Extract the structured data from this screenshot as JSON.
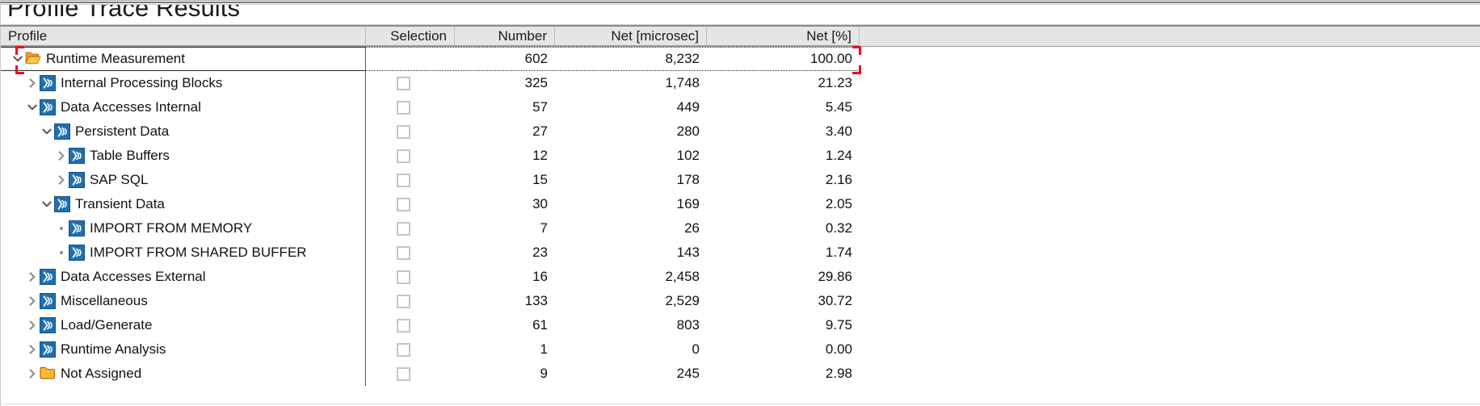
{
  "window": {
    "title": "Profile Trace Results"
  },
  "colors": {
    "header_bg": "#e6e6e6",
    "selection_marker": "#e81123",
    "folder_icon": "#f5b324",
    "node_icon": "#1e6eb4",
    "text": "#111111",
    "grid_line": "#bdbdbd"
  },
  "table": {
    "columns": [
      {
        "key": "profile",
        "label": "Profile",
        "align": "left"
      },
      {
        "key": "selection",
        "label": "Selection",
        "align": "right"
      },
      {
        "key": "number",
        "label": "Number",
        "align": "right"
      },
      {
        "key": "net_microsec",
        "label": "Net [microsec]",
        "align": "right"
      },
      {
        "key": "net_percent",
        "label": "Net [%]",
        "align": "right"
      }
    ],
    "rows": [
      {
        "label": "Runtime Measurement",
        "depth": 0,
        "twisty": "expanded",
        "icon": "folder-open-icon",
        "checkbox": false,
        "selected": true,
        "number": "602",
        "net_microsec": "8,232",
        "net_percent": "100.00"
      },
      {
        "label": "Internal Processing Blocks",
        "depth": 1,
        "twisty": "collapsed",
        "icon": "trace-node-icon",
        "checkbox": true,
        "checked": false,
        "selected": false,
        "number": "325",
        "net_microsec": "1,748",
        "net_percent": "21.23"
      },
      {
        "label": "Data Accesses Internal",
        "depth": 1,
        "twisty": "expanded",
        "icon": "trace-node-icon",
        "checkbox": true,
        "checked": false,
        "selected": false,
        "number": "57",
        "net_microsec": "449",
        "net_percent": "5.45"
      },
      {
        "label": "Persistent Data",
        "depth": 2,
        "twisty": "expanded",
        "icon": "trace-node-icon",
        "checkbox": true,
        "checked": false,
        "selected": false,
        "number": "27",
        "net_microsec": "280",
        "net_percent": "3.40"
      },
      {
        "label": "Table Buffers",
        "depth": 3,
        "twisty": "collapsed",
        "icon": "trace-node-icon",
        "checkbox": true,
        "checked": false,
        "selected": false,
        "number": "12",
        "net_microsec": "102",
        "net_percent": "1.24"
      },
      {
        "label": "SAP SQL",
        "depth": 3,
        "twisty": "collapsed",
        "icon": "trace-node-icon",
        "checkbox": true,
        "checked": false,
        "selected": false,
        "number": "15",
        "net_microsec": "178",
        "net_percent": "2.16"
      },
      {
        "label": "Transient Data",
        "depth": 2,
        "twisty": "expanded",
        "icon": "trace-node-icon",
        "checkbox": true,
        "checked": false,
        "selected": false,
        "number": "30",
        "net_microsec": "169",
        "net_percent": "2.05"
      },
      {
        "label": "IMPORT FROM MEMORY",
        "depth": 3,
        "twisty": "leaf",
        "icon": "trace-node-icon",
        "checkbox": true,
        "checked": false,
        "selected": false,
        "number": "7",
        "net_microsec": "26",
        "net_percent": "0.32"
      },
      {
        "label": "IMPORT FROM SHARED BUFFER",
        "depth": 3,
        "twisty": "leaf",
        "icon": "trace-node-icon",
        "checkbox": true,
        "checked": false,
        "selected": false,
        "number": "23",
        "net_microsec": "143",
        "net_percent": "1.74"
      },
      {
        "label": "Data Accesses External",
        "depth": 1,
        "twisty": "collapsed",
        "icon": "trace-node-icon",
        "checkbox": true,
        "checked": false,
        "selected": false,
        "number": "16",
        "net_microsec": "2,458",
        "net_percent": "29.86"
      },
      {
        "label": "Miscellaneous",
        "depth": 1,
        "twisty": "collapsed",
        "icon": "trace-node-icon",
        "checkbox": true,
        "checked": false,
        "selected": false,
        "number": "133",
        "net_microsec": "2,529",
        "net_percent": "30.72"
      },
      {
        "label": "Load/Generate",
        "depth": 1,
        "twisty": "collapsed",
        "icon": "trace-node-icon",
        "checkbox": true,
        "checked": false,
        "selected": false,
        "number": "61",
        "net_microsec": "803",
        "net_percent": "9.75"
      },
      {
        "label": "Runtime Analysis",
        "depth": 1,
        "twisty": "collapsed",
        "icon": "trace-node-icon",
        "checkbox": true,
        "checked": false,
        "selected": false,
        "number": "1",
        "net_microsec": "0",
        "net_percent": "0.00"
      },
      {
        "label": "Not Assigned",
        "depth": 1,
        "twisty": "collapsed",
        "icon": "folder-closed-icon",
        "checkbox": true,
        "checked": false,
        "selected": false,
        "number": "9",
        "net_microsec": "245",
        "net_percent": "2.98"
      }
    ]
  }
}
